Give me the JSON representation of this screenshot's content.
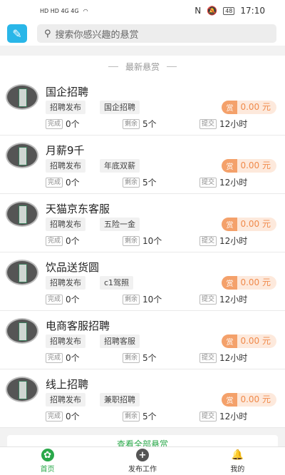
{
  "status": {
    "left_icons": "HD HD 4G 4G",
    "time": "17:10",
    "battery": "48"
  },
  "search": {
    "placeholder": "搜索你感兴趣的悬赏"
  },
  "section_title": "最新悬赏",
  "labels": {
    "done": "完成",
    "remain": "剩余",
    "submit": "提交",
    "reward_icon": "赏"
  },
  "items": [
    {
      "title": "国企招聘",
      "tag1": "招聘发布",
      "tag2": "国企招聘",
      "reward": "0.00 元",
      "done": "0个",
      "remain": "5个",
      "submit": "12小时"
    },
    {
      "title": "月薪9千",
      "tag1": "招聘发布",
      "tag2": "年底双薪",
      "reward": "0.00 元",
      "done": "0个",
      "remain": "5个",
      "submit": "12小时"
    },
    {
      "title": "天猫京东客服",
      "tag1": "招聘发布",
      "tag2": "五险一金",
      "reward": "0.00 元",
      "done": "0个",
      "remain": "10个",
      "submit": "12小时"
    },
    {
      "title": "饮品送货圆",
      "tag1": "招聘发布",
      "tag2": "c1驾照",
      "reward": "0.00 元",
      "done": "0个",
      "remain": "10个",
      "submit": "12小时"
    },
    {
      "title": "电商客服招聘",
      "tag1": "招聘发布",
      "tag2": "招聘客服",
      "reward": "0.00 元",
      "done": "0个",
      "remain": "5个",
      "submit": "12小时"
    },
    {
      "title": "线上招聘",
      "tag1": "招聘发布",
      "tag2": "兼职招聘",
      "reward": "0.00 元",
      "done": "0个",
      "remain": "5个",
      "submit": "12小时"
    }
  ],
  "view_all": "查看全部悬赏",
  "tabs": {
    "home": "首页",
    "publish": "发布工作",
    "mine": "我的"
  },
  "colors": {
    "accent": "#2aa84a",
    "reward": "#f08a4b",
    "app_icon": "#29b6e8"
  }
}
